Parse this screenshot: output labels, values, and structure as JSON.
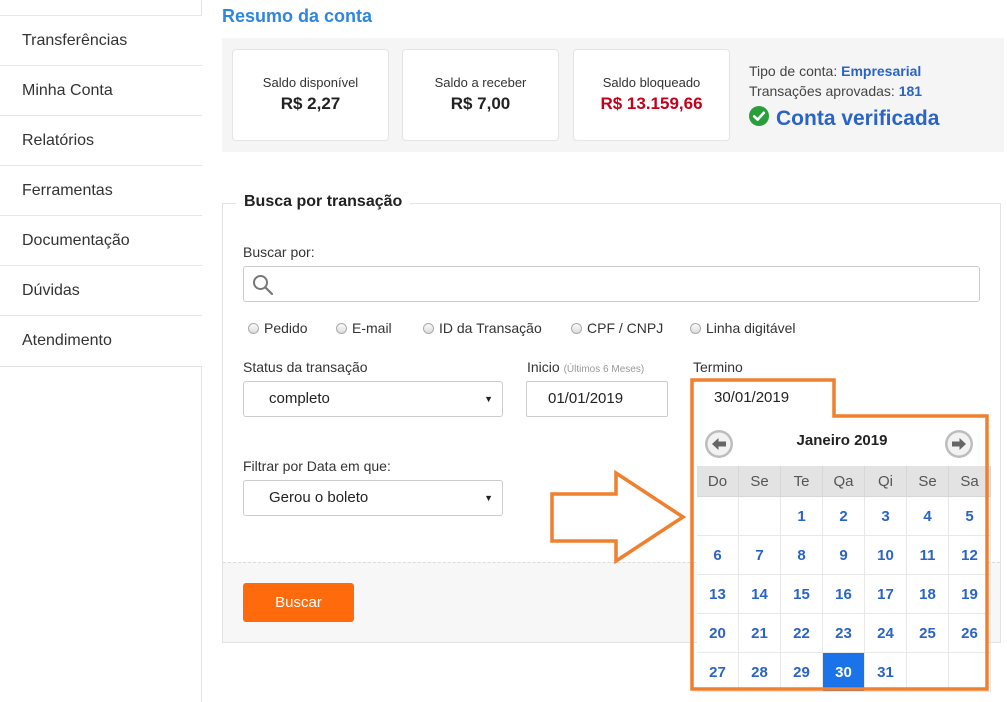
{
  "sidebar": {
    "items": [
      {
        "label": "Transferências"
      },
      {
        "label": "Minha Conta"
      },
      {
        "label": "Relatórios"
      },
      {
        "label": "Ferramentas"
      },
      {
        "label": "Documentação"
      },
      {
        "label": "Dúvidas"
      },
      {
        "label": "Atendimento"
      }
    ]
  },
  "summary": {
    "title": "Resumo da conta",
    "cards": [
      {
        "label": "Saldo disponível",
        "value": "R$ 2,27"
      },
      {
        "label": "Saldo a receber",
        "value": "R$ 7,00"
      },
      {
        "label": "Saldo bloqueado",
        "value": "R$ 13.159,66",
        "color": "#c4001d"
      }
    ],
    "account_type_label": "Tipo de conta:",
    "account_type_value": "Empresarial",
    "approved_label": "Transações aprovadas:",
    "approved_value": "181",
    "verified_text": "Conta verificada",
    "verified_icon": "check-circle-icon",
    "verified_color": "#2a9d3d"
  },
  "search": {
    "legend": "Busca por transação",
    "buscar_por_label": "Buscar por:",
    "search_icon": "search-icon",
    "radios": [
      {
        "label": "Pedido"
      },
      {
        "label": "E-mail"
      },
      {
        "label": "ID da Transação"
      },
      {
        "label": "CPF / CNPJ"
      },
      {
        "label": "Linha digitável"
      }
    ],
    "status_label": "Status da transação",
    "status_value": "completo",
    "inicio_label": "Inicio",
    "inicio_hint": "(Últimos 6 Meses)",
    "inicio_value": "01/01/2019",
    "termino_label": "Termino",
    "termino_value": "30/01/2019",
    "filter_label": "Filtrar por Data em que:",
    "filter_value": "Gerou o boleto",
    "button_label": "Buscar",
    "button_color": "#ff6a0d"
  },
  "calendar": {
    "month_label": "Janeiro 2019",
    "prev_icon": "arrow-left-circle-icon",
    "next_icon": "arrow-right-circle-icon",
    "weekdays": [
      "Do",
      "Se",
      "Te",
      "Qa",
      "Qi",
      "Se",
      "Sa"
    ],
    "weeks": [
      [
        "",
        "",
        "1",
        "2",
        "3",
        "4",
        "5"
      ],
      [
        "6",
        "7",
        "8",
        "9",
        "10",
        "11",
        "12"
      ],
      [
        "13",
        "14",
        "15",
        "16",
        "17",
        "18",
        "19"
      ],
      [
        "20",
        "21",
        "22",
        "23",
        "24",
        "25",
        "26"
      ],
      [
        "27",
        "28",
        "29",
        "30",
        "31",
        "",
        ""
      ]
    ],
    "selected_day": "30",
    "selected_color": "#1a73e8"
  },
  "annotation": {
    "highlight_color": "#f07f2e",
    "arrow_icon": "right-arrow-icon"
  }
}
